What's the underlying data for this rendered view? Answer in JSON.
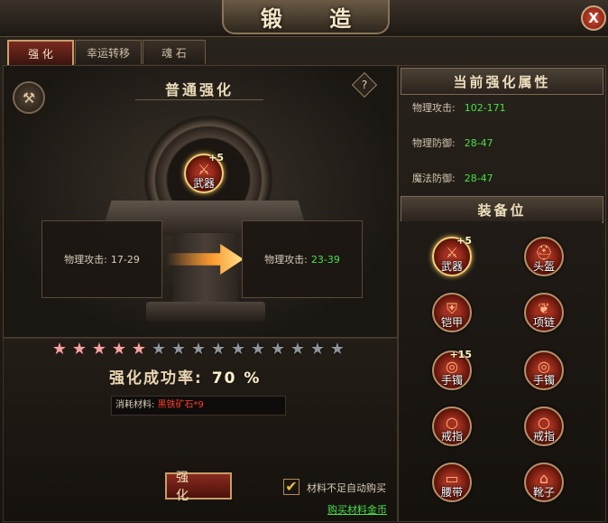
{
  "window": {
    "title": "锻 造",
    "close_label": "X"
  },
  "tabs": [
    {
      "label": "强 化",
      "active": true
    },
    {
      "label": "幸运转移",
      "active": false
    },
    {
      "label": "魂 石",
      "active": false
    }
  ],
  "forge": {
    "section_title": "普通强化",
    "help_label": "?",
    "selected_item": {
      "name": "武器",
      "level": "+5"
    },
    "current_stat_label": "物理攻击:",
    "current_stat_value": "17-29",
    "next_stat_label": "物理攻击:",
    "next_stat_value": "23-39",
    "stars_lit": 5,
    "stars_total": 15,
    "success_rate_label": "强化成功率:",
    "success_rate_value": "70 %",
    "material_label": "消耗材料:",
    "material_name": "黑铁矿石*9",
    "strengthen_button": "强 化",
    "auto_buy_label": "材料不足自动购买",
    "auto_buy_checked": true,
    "buy_link": "购买材料金币"
  },
  "attributes": {
    "header": "当前强化属性",
    "rows": [
      {
        "label": "物理攻击:",
        "value": "102-171"
      },
      {
        "label": "物理防御:",
        "value": "28-47"
      },
      {
        "label": "魔法防御:",
        "value": "28-47"
      }
    ]
  },
  "equipment": {
    "header": "装备位",
    "slots": [
      {
        "name": "武器",
        "level": "+5",
        "icon": "sword-icon",
        "selected": true
      },
      {
        "name": "头盔",
        "level": "",
        "icon": "helmet-icon",
        "selected": false
      },
      {
        "name": "铠甲",
        "level": "",
        "icon": "armor-icon",
        "selected": false
      },
      {
        "name": "项链",
        "level": "",
        "icon": "necklace-icon",
        "selected": false
      },
      {
        "name": "手镯",
        "level": "+15",
        "icon": "bracelet-icon",
        "selected": false
      },
      {
        "name": "手镯",
        "level": "",
        "icon": "bracelet-icon",
        "selected": false
      },
      {
        "name": "戒指",
        "level": "",
        "icon": "ring-icon",
        "selected": false
      },
      {
        "name": "戒指",
        "level": "",
        "icon": "ring-icon",
        "selected": false
      },
      {
        "name": "腰带",
        "level": "",
        "icon": "belt-icon",
        "selected": false
      },
      {
        "name": "靴子",
        "level": "",
        "icon": "boots-icon",
        "selected": false
      }
    ]
  },
  "colors": {
    "accent_gold": "#c79d66",
    "stat_green": "#46e046",
    "material_red": "#ff3a2a"
  }
}
